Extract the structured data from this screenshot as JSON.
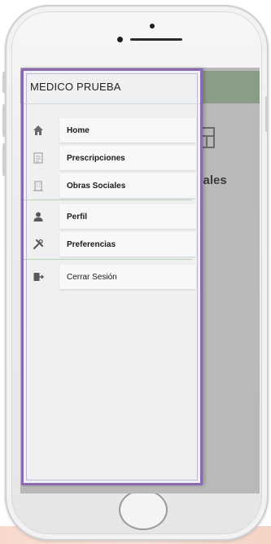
{
  "drawer": {
    "title": "MEDICO PRUEBA",
    "items": [
      {
        "label": "Home",
        "icon": "home-icon"
      },
      {
        "label": "Prescripciones",
        "icon": "prescription-icon"
      },
      {
        "label": "Obras Sociales",
        "icon": "building-icon"
      },
      {
        "label": "Perfil",
        "icon": "user-icon"
      },
      {
        "label": "Preferencias",
        "icon": "tools-icon"
      },
      {
        "label": "Cerrar Sesión",
        "icon": "logout-icon"
      }
    ]
  },
  "background": {
    "partial_text": "ciales"
  },
  "colors": {
    "drawer_border": "#8a6ab0",
    "header_green": "#8a9d86",
    "separator_green": "#b8d2b3"
  }
}
